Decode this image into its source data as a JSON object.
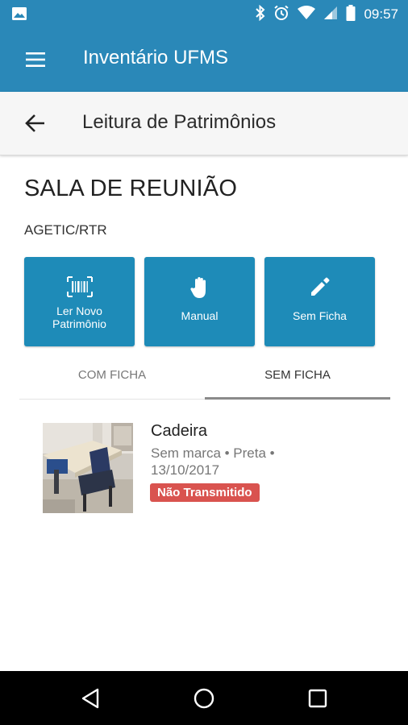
{
  "status_bar": {
    "time": "09:57",
    "icons": [
      "image-icon",
      "bluetooth-icon",
      "alarm-icon",
      "wifi-icon",
      "signal-icon",
      "battery-icon"
    ]
  },
  "app_bar": {
    "title": "Inventário UFMS",
    "menu_icon": "hamburger-menu-icon"
  },
  "sub_header": {
    "title": "Leitura de Patrimônios",
    "back_icon": "arrow-back-icon"
  },
  "room": {
    "name": "SALA DE REUNIÃO",
    "code": "AGETIC/RTR"
  },
  "actions": [
    {
      "label": "Ler Novo Patrimônio",
      "icon": "barcode-icon"
    },
    {
      "label": "Manual",
      "icon": "hand-icon"
    },
    {
      "label": "Sem Ficha",
      "icon": "pencil-icon"
    }
  ],
  "tabs": [
    {
      "label": "COM FICHA",
      "active": false
    },
    {
      "label": "SEM FICHA",
      "active": true
    }
  ],
  "items": [
    {
      "name": "Cadeira",
      "description": "Sem marca • Preta • 13/10/2017",
      "badge": "Não Transmitido",
      "badge_color": "#d9534f"
    }
  ],
  "colors": {
    "primary": "#2a88b8",
    "button": "#1e8bb8",
    "badge": "#d9534f"
  }
}
